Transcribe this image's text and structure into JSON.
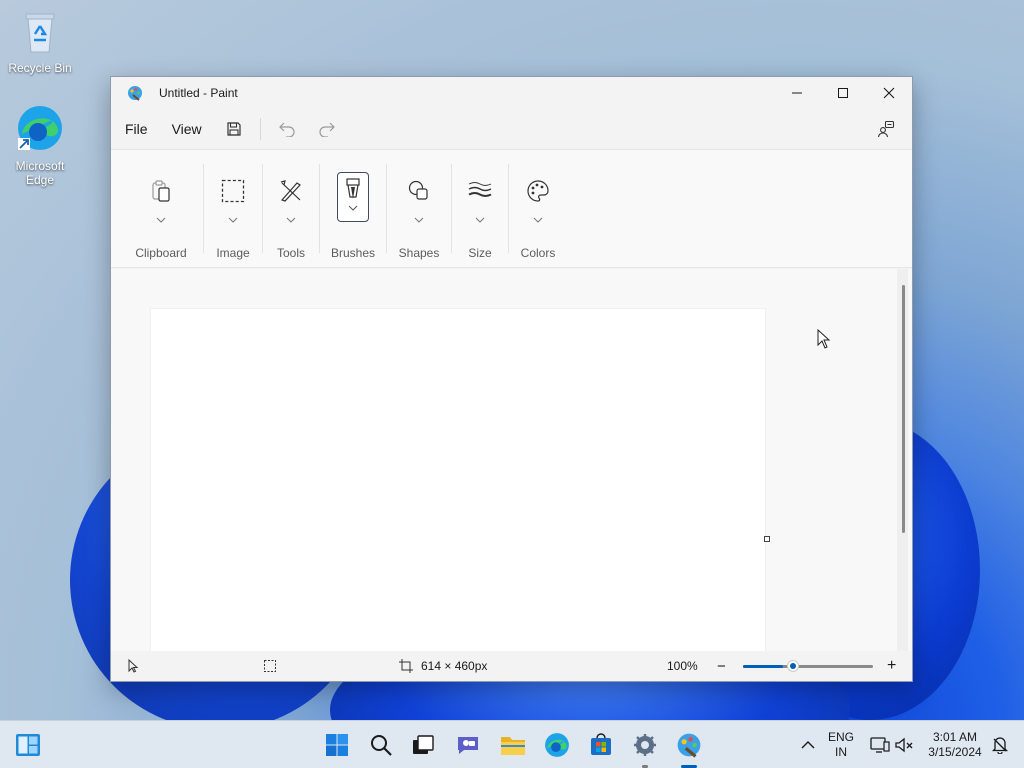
{
  "desktop": {
    "icons": [
      {
        "label": "Recycle Bin",
        "icon": "recycle-bin-icon"
      },
      {
        "label": "Microsoft Edge",
        "icon": "edge-icon"
      }
    ]
  },
  "window": {
    "title": "Untitled - Paint",
    "controls": [
      "minimize-icon",
      "maximize-icon",
      "close-icon"
    ]
  },
  "menubar": {
    "file": "File",
    "view": "View",
    "tools": [
      "save-icon",
      "undo-icon",
      "redo-icon"
    ],
    "share": "share-icon"
  },
  "ribbon": {
    "groups": [
      {
        "label": "Clipboard",
        "icon": "clipboard-icon"
      },
      {
        "label": "Image",
        "icon": "selection-icon"
      },
      {
        "label": "Tools",
        "icon": "tools-icon"
      },
      {
        "label": "Brushes",
        "icon": "brush-icon",
        "active": true
      },
      {
        "label": "Shapes",
        "icon": "shapes-icon"
      },
      {
        "label": "Size",
        "icon": "size-icon"
      },
      {
        "label": "Colors",
        "icon": "palette-icon"
      }
    ]
  },
  "canvas": {
    "background": "#ffffff"
  },
  "statusbar": {
    "canvas_size": "614 × 460px",
    "zoom": "100%",
    "zoom_minus": "−",
    "zoom_plus": "+",
    "zoom_level_fraction": 0.34
  },
  "taskbar": {
    "apps": [
      "start-icon",
      "search-icon",
      "task-view-icon",
      "chat-icon",
      "file-explorer-icon",
      "edge-icon",
      "store-icon",
      "settings-app-icon",
      "paint-icon"
    ],
    "language_line1": "ENG",
    "language_line2": "IN",
    "time": "3:01 AM",
    "date": "3/15/2024"
  },
  "colors": {
    "accent": "#005fb8",
    "window_bg": "#f3f3f3",
    "taskbar_bg": "#dfe7f1"
  }
}
